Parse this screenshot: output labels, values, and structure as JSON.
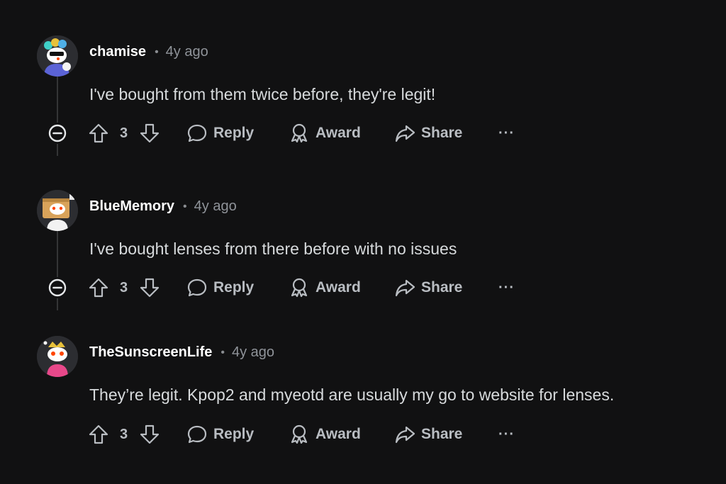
{
  "comments": [
    {
      "username": "chamise",
      "separator": "•",
      "time": "4y ago",
      "body": "I've bought from them twice before, they're legit!",
      "votes": "3",
      "reply_label": "Reply",
      "award_label": "Award",
      "share_label": "Share",
      "more_label": "···",
      "collapsible": true
    },
    {
      "username": "BlueMemory",
      "separator": "•",
      "time": "4y ago",
      "body": "I've bought lenses from there before with no issues",
      "votes": "3",
      "reply_label": "Reply",
      "award_label": "Award",
      "share_label": "Share",
      "more_label": "···",
      "collapsible": true
    },
    {
      "username": "TheSunscreenLife",
      "separator": "•",
      "time": "4y ago",
      "body": "They’re legit. Kpop2 and myeotd are usually my go to website for lenses.",
      "votes": "3",
      "reply_label": "Reply",
      "award_label": "Award",
      "share_label": "Share",
      "more_label": "···",
      "collapsible": false
    }
  ],
  "icons": {
    "upvote": "upvote-arrow-icon",
    "downvote": "downvote-arrow-icon",
    "reply": "speech-bubble-icon",
    "award": "award-ribbon-icon",
    "share": "share-arrow-icon",
    "collapse": "collapse-minus-icon"
  },
  "colors": {
    "background": "#111112",
    "username": "#ffffff",
    "text": "#d7dadc",
    "muted": "#b9bdc2",
    "thread_line": "#343536"
  }
}
